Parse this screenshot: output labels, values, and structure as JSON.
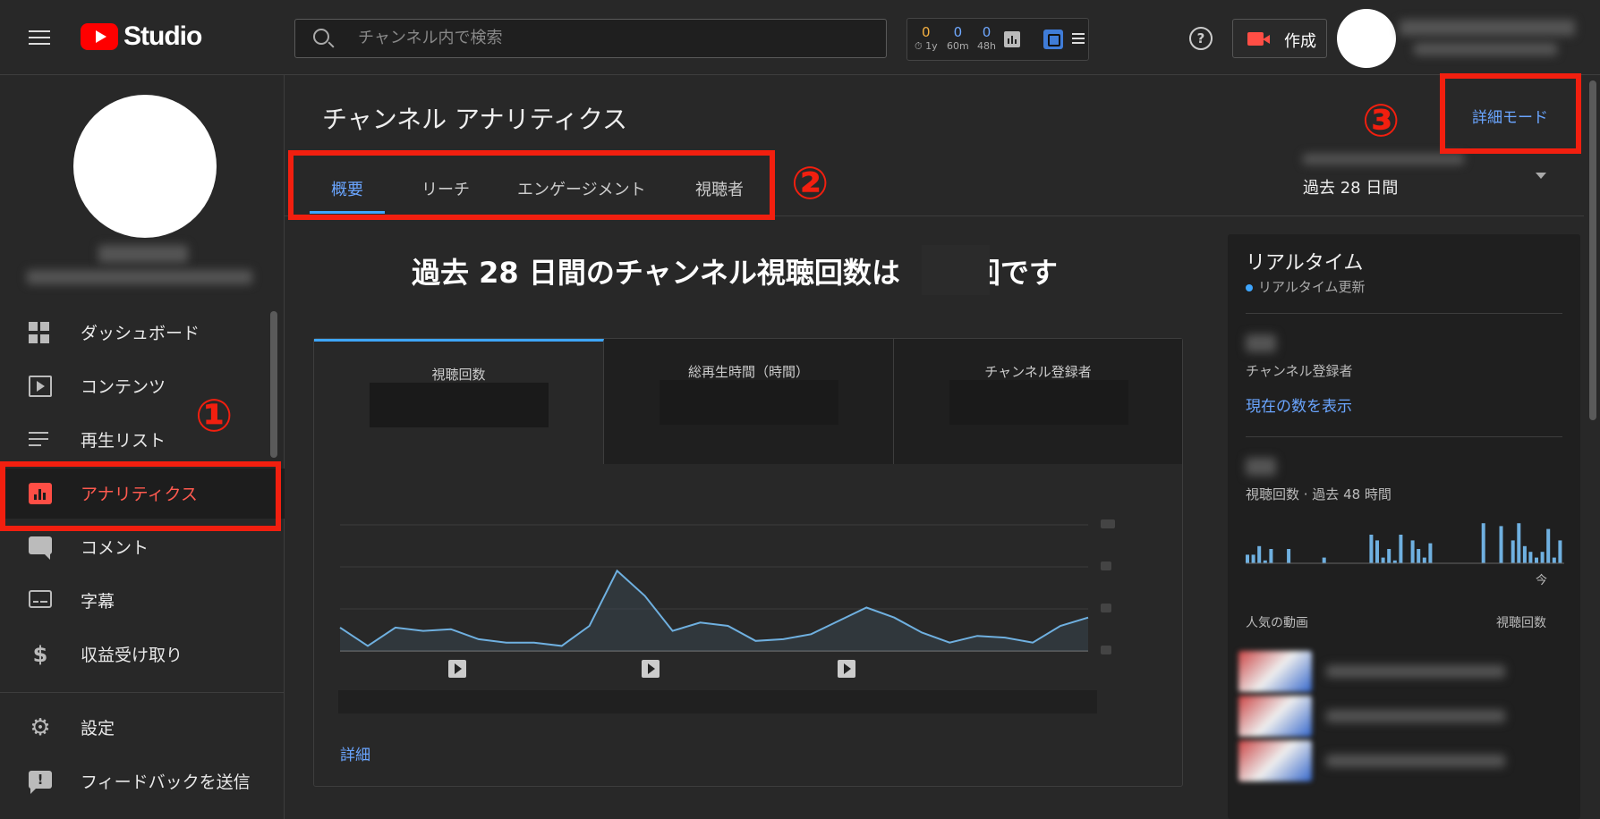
{
  "header": {
    "logo_text": "Studio",
    "search_placeholder": "チャンネル内で検索",
    "stats": [
      {
        "value": "0",
        "label": "⏱ 1y",
        "color": "#f5b041"
      },
      {
        "value": "0",
        "label": "60m",
        "color": "#6fa8ff"
      },
      {
        "value": "0",
        "label": "48h",
        "color": "#6fa8ff"
      }
    ],
    "help_symbol": "?",
    "create_label": "作成"
  },
  "sidebar": {
    "items": [
      {
        "label": "ダッシュボード",
        "icon": "dashboard-icon"
      },
      {
        "label": "コンテンツ",
        "icon": "content-icon"
      },
      {
        "label": "再生リスト",
        "icon": "playlist-icon"
      },
      {
        "label": "アナリティクス",
        "icon": "analytics-icon",
        "active": true
      },
      {
        "label": "コメント",
        "icon": "comment-icon"
      },
      {
        "label": "字幕",
        "icon": "subtitles-icon"
      },
      {
        "label": "収益受け取り",
        "icon": "dollar-icon"
      }
    ],
    "bottom_items": [
      {
        "label": "設定",
        "icon": "gear-icon"
      },
      {
        "label": "フィードバックを送信",
        "icon": "feedback-icon"
      }
    ]
  },
  "annotations": {
    "one": "①",
    "two": "②",
    "three": "③",
    "color": "#f21f0f"
  },
  "main": {
    "title": "チャンネル アナリティクス",
    "tabs": [
      "概要",
      "リーチ",
      "エンゲージメント",
      "視聴者"
    ],
    "active_tab": "概要",
    "detail_mode": "詳細モード",
    "date_range": "過去 28 日間",
    "headline_prefix": "過去 28 日間のチャンネル視聴回数は",
    "headline_suffix": "回です",
    "metrics": [
      "視聴回数",
      "総再生時間（時間）",
      "チャンネル登録者"
    ],
    "detail_link": "詳細"
  },
  "chart_data": {
    "type": "area",
    "series": [
      {
        "values": [
          14,
          3,
          14,
          12,
          13,
          7,
          5,
          5,
          3,
          15,
          48,
          33,
          12,
          17,
          15,
          6,
          7,
          10,
          18,
          26,
          20,
          11,
          5,
          9,
          8,
          5,
          15,
          20
        ]
      }
    ],
    "accent": "#6fb0e0"
  },
  "realtime": {
    "title": "リアルタイム",
    "live_label": "リアルタイム更新",
    "subscribers_label": "チャンネル登録者",
    "show_count": "現在の数を表示",
    "views_label": "視聴回数 · 過去 48 時間",
    "now_label": "今",
    "popular_label": "人気の動画",
    "popular_right": "視聴回数",
    "bars": [
      3,
      3,
      6,
      1,
      5,
      0,
      0,
      5,
      0,
      0,
      0,
      0,
      0,
      2,
      0,
      0,
      0,
      0,
      0,
      0,
      0,
      10,
      8,
      2,
      5,
      1,
      10,
      0,
      8,
      5,
      2,
      7,
      0,
      0,
      0,
      0,
      0,
      0,
      0,
      0,
      14,
      0,
      0,
      13,
      0,
      8,
      14,
      6,
      4,
      2,
      4,
      12,
      2,
      8
    ]
  }
}
